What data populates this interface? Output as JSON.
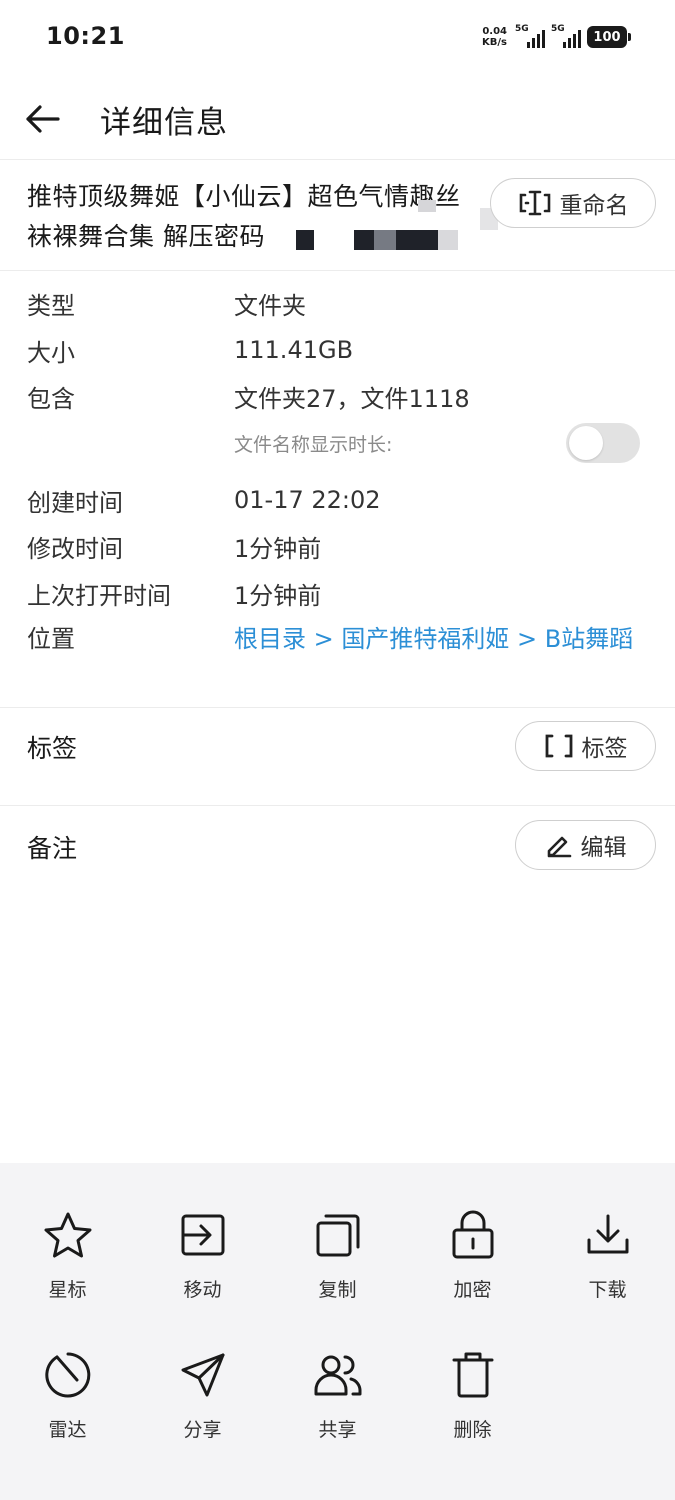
{
  "status_bar": {
    "time": "10:21",
    "net_speed_value": "0.04",
    "net_speed_unit": "KB/s",
    "sim1_tag": "5G",
    "sim2_tag": "5G",
    "battery": "100"
  },
  "header": {
    "back_icon": "arrow-left-icon",
    "title": "详细信息"
  },
  "file": {
    "name": "推特顶级舞姬【小仙云】超色气情趣丝袜裸舞合集 解压密码",
    "rename_label": "重命名"
  },
  "details": {
    "type_label": "类型",
    "type_value": "文件夹",
    "size_label": "大小",
    "size_value": "111.41GB",
    "contains_label": "包含",
    "contains_value": "文件夹27，文件1118",
    "show_duration_label": "文件名称显示时长:",
    "show_duration_enabled": false,
    "created_label": "创建时间",
    "created_value": "01-17 22:02",
    "modified_label": "修改时间",
    "modified_value": "1分钟前",
    "opened_label": "上次打开时间",
    "opened_value": "1分钟前",
    "location_label": "位置",
    "location_value": "根目录 > 国产推特福利姬 > B站舞蹈"
  },
  "tags": {
    "label": "标签",
    "button_label": "标签"
  },
  "notes": {
    "label": "备注",
    "button_label": "编辑"
  },
  "actions": [
    {
      "label": "星标",
      "icon": "star-icon"
    },
    {
      "label": "移动",
      "icon": "move-icon"
    },
    {
      "label": "复制",
      "icon": "copy-icon"
    },
    {
      "label": "加密",
      "icon": "lock-icon"
    },
    {
      "label": "下载",
      "icon": "download-icon"
    },
    {
      "label": "雷达",
      "icon": "radar-icon"
    },
    {
      "label": "分享",
      "icon": "send-icon"
    },
    {
      "label": "共享",
      "icon": "users-icon"
    },
    {
      "label": "删除",
      "icon": "trash-icon"
    }
  ],
  "colors": {
    "link": "#2c8fd6",
    "action_sheet_bg": "#f4f4f6",
    "toggle_off": "#e2e2e2"
  }
}
